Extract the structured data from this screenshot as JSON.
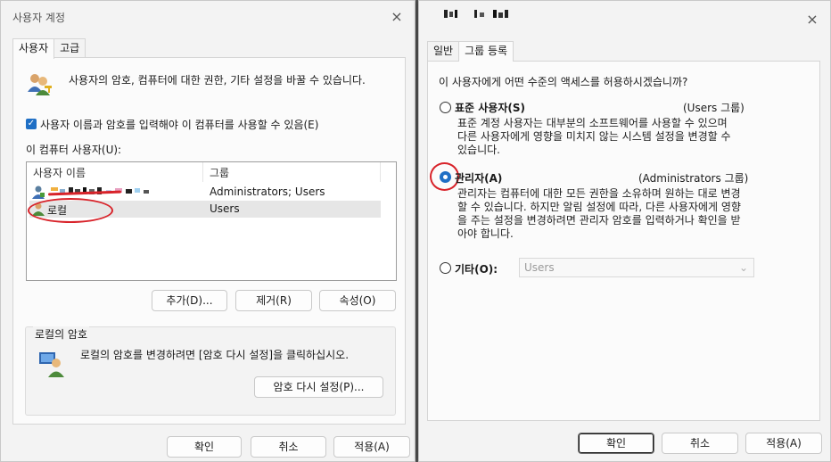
{
  "left_window": {
    "title": "사용자 계정",
    "close_icon": "×",
    "tabs": [
      "사용자",
      "고급"
    ],
    "intro": "사용자의 암호, 컴퓨터에 대한 권한, 기타 설정을 바꿀 수 있습니다.",
    "require_login_checkbox": {
      "label": "사용자 이름과 암호를 입력해야 이 컴퓨터를 사용할 수 있음(E)",
      "checked": true
    },
    "users_label": "이 컴퓨터 사용자(U):",
    "columns": [
      "사용자 이름",
      "그룹"
    ],
    "rows": [
      {
        "name": "",
        "group": "Administrators; Users"
      },
      {
        "name": "로컬",
        "group": "Users"
      }
    ],
    "buttons": {
      "add": "추가(D)...",
      "remove": "제거(R)",
      "properties": "속성(O)"
    },
    "password_group": {
      "title": "로컬의 암호",
      "text": "로컬의 암호를 변경하려면 [암호 다시 설정]을 클릭하십시오.",
      "reset_button": "암호 다시 설정(P)..."
    },
    "footer": {
      "ok": "확인",
      "cancel": "취소",
      "apply": "적용(A)"
    }
  },
  "right_window": {
    "close_icon": "×",
    "tabs": [
      "일반",
      "그룹 등록"
    ],
    "question": "이 사용자에게 어떤 수준의 액세스를 허용하시겠습니까?",
    "options": [
      {
        "label": "표준 사용자(S)",
        "group": "(Users 그룹)",
        "desc": [
          "표준 계정 사용자는 대부분의 소프트웨어를 사용할 수 있으며",
          "다른 사용자에게 영향을 미치지 않는 시스템 설정을 변경할 수",
          "있습니다."
        ],
        "selected": false
      },
      {
        "label": "관리자(A)",
        "group": "(Administrators 그룹)",
        "desc": [
          "관리자는 컴퓨터에 대한 모든 권한을 소유하며 원하는 대로 변경",
          "할 수 있습니다. 하지만 알림 설정에 따라, 다른 사용자에게 영향",
          "을 주는 설정을 변경하려면 관리자 암호를 입력하거나 확인을 받",
          "아야 합니다."
        ],
        "selected": true
      },
      {
        "label": "기타(O):",
        "combo_value": "Users",
        "selected": false
      }
    ],
    "footer": {
      "ok": "확인",
      "cancel": "취소",
      "apply": "적용(A)"
    }
  },
  "colors": {
    "accent": "#1f6fc5",
    "annotation": "#d8232a"
  }
}
